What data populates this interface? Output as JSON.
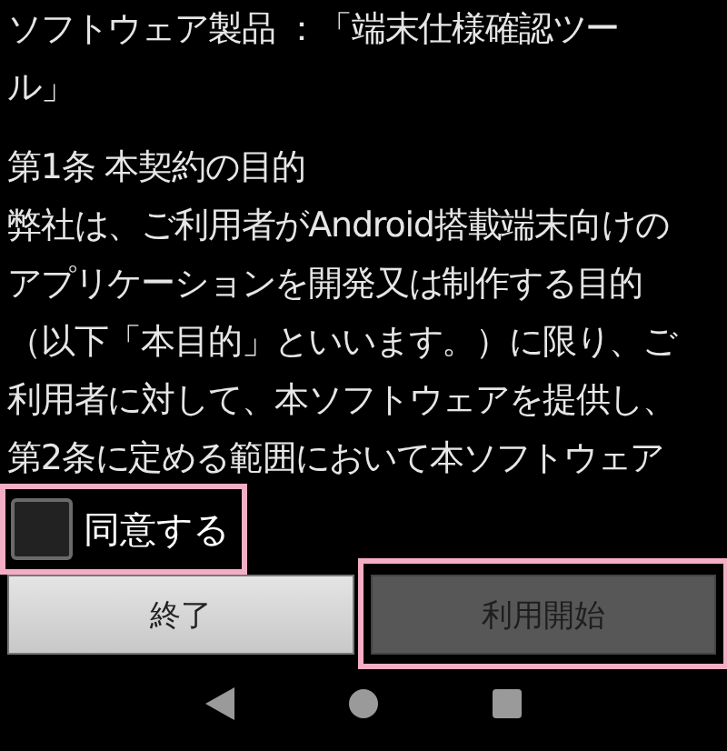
{
  "title_lines": [
    "ソフトウェア製品 ：「端末仕様確認ツー",
    "ル」"
  ],
  "article_lines": [
    "第1条 本契約の目的",
    "弊社は、ご利用者がAndroid搭載端末向けの",
    "アプリケーションを開発又は制作する目的",
    "（以下「本目的」といいます。）に限り、ご",
    "利用者に対して、本ソフトウェアを提供し、",
    "第2条に定める範囲において本ソフトウェア"
  ],
  "agree": {
    "label": "同意する",
    "checked": false,
    "highlighted": true
  },
  "buttons": [
    {
      "label": "終了",
      "disabled": false,
      "highlighted": false
    },
    {
      "label": "利用開始",
      "disabled": true,
      "highlighted": true
    }
  ]
}
